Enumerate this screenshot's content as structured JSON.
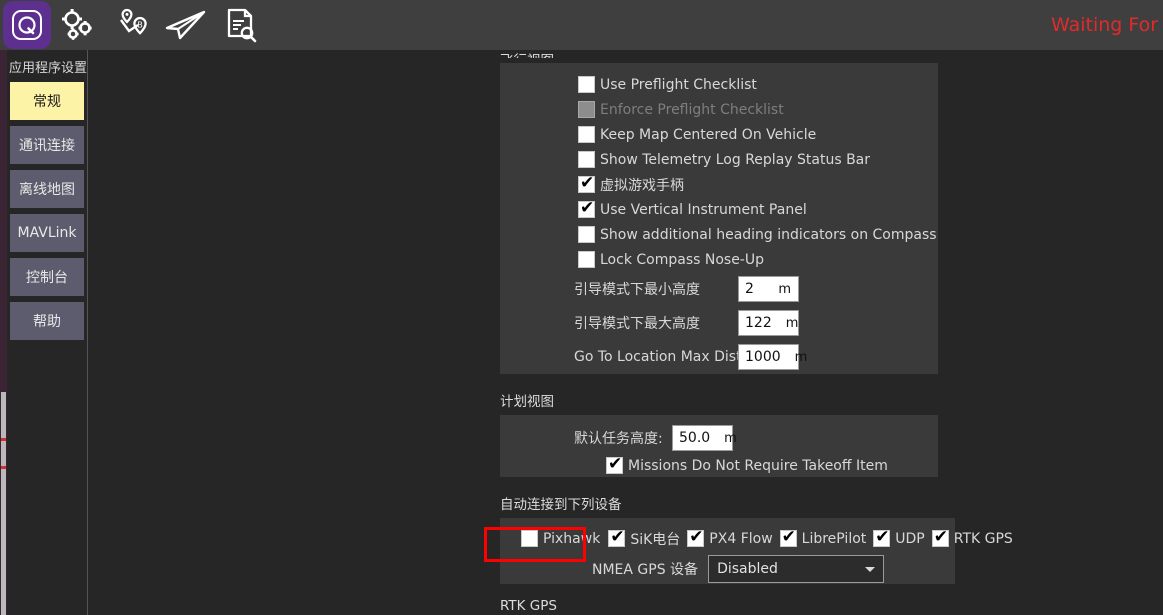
{
  "toolbar": {
    "icons": [
      {
        "name": "qgroundcontrol-logo-icon",
        "label": "Q"
      },
      {
        "name": "settings-gears-icon",
        "label": "Settings"
      },
      {
        "name": "plan-waypoints-icon",
        "label": "Plan"
      },
      {
        "name": "fly-paperplane-icon",
        "label": "Fly"
      },
      {
        "name": "analyze-document-icon",
        "label": "Analyze"
      }
    ],
    "status_text": "Waiting For Vehicle Connection"
  },
  "sidebar": {
    "title": "应用程序设置",
    "items": [
      {
        "label": "常规",
        "active": true
      },
      {
        "label": "通讯连接",
        "active": false
      },
      {
        "label": "离线地图",
        "active": false
      },
      {
        "label": "MAVLink",
        "active": false
      },
      {
        "label": "控制台",
        "active": false
      },
      {
        "label": "帮助",
        "active": false
      }
    ]
  },
  "general": {
    "top_section_clipped": "飞行视图",
    "checkboxes": [
      {
        "label": "Use Preflight Checklist",
        "checked": false,
        "disabled": false
      },
      {
        "label": "Enforce Preflight Checklist",
        "checked": false,
        "disabled": true
      },
      {
        "label": "Keep Map Centered On Vehicle",
        "checked": false,
        "disabled": false
      },
      {
        "label": "Show Telemetry Log Replay Status Bar",
        "checked": false,
        "disabled": false
      },
      {
        "label": "虚拟游戏手柄",
        "checked": true,
        "disabled": false
      },
      {
        "label": "Use Vertical Instrument Panel",
        "checked": true,
        "disabled": false
      },
      {
        "label": "Show additional heading indicators on Compass",
        "checked": false,
        "disabled": false
      },
      {
        "label": "Lock Compass Nose-Up",
        "checked": false,
        "disabled": false
      }
    ],
    "fields": [
      {
        "label": "引导模式下最小高度",
        "value": "2",
        "unit": "m"
      },
      {
        "label": "引导模式下最大高度",
        "value": "122",
        "unit": "m"
      },
      {
        "label": "Go To Location Max Distance",
        "value": "1000",
        "unit": "m"
      }
    ]
  },
  "plan_view": {
    "section_title": "计划视图",
    "default_altitude_label": "默认任务高度:",
    "default_altitude_value": "50.0",
    "default_altitude_unit": "m",
    "takeoff_checkbox": {
      "label": "Missions Do Not Require Takeoff Item",
      "checked": true
    }
  },
  "autoconnect": {
    "section_title": "自动连接到下列设备",
    "devices": [
      {
        "label": "Pixhawk",
        "checked": false,
        "highlighted": true
      },
      {
        "label": "SiK电台",
        "checked": true,
        "highlighted": false
      },
      {
        "label": "PX4 Flow",
        "checked": true,
        "highlighted": false
      },
      {
        "label": "LibrePilot",
        "checked": true,
        "highlighted": false
      },
      {
        "label": "UDP",
        "checked": true,
        "highlighted": false
      },
      {
        "label": "RTK GPS",
        "checked": true,
        "highlighted": false
      }
    ],
    "nmea_label": "NMEA GPS 设备",
    "nmea_value": "Disabled",
    "nmea_options": [
      "Disabled"
    ]
  },
  "bottom_section_clipped": "RTK GPS",
  "colors": {
    "page_bg": "#262626",
    "toolbar_bg": "#3f3f3f",
    "group_bg": "#3a3a3a",
    "accent_purple": "#5d2f8f",
    "active_tab": "#fdf3a7",
    "button_bg": "#5c5c6e",
    "status_red": "#e02b2b",
    "highlight_red": "#ff0000"
  }
}
